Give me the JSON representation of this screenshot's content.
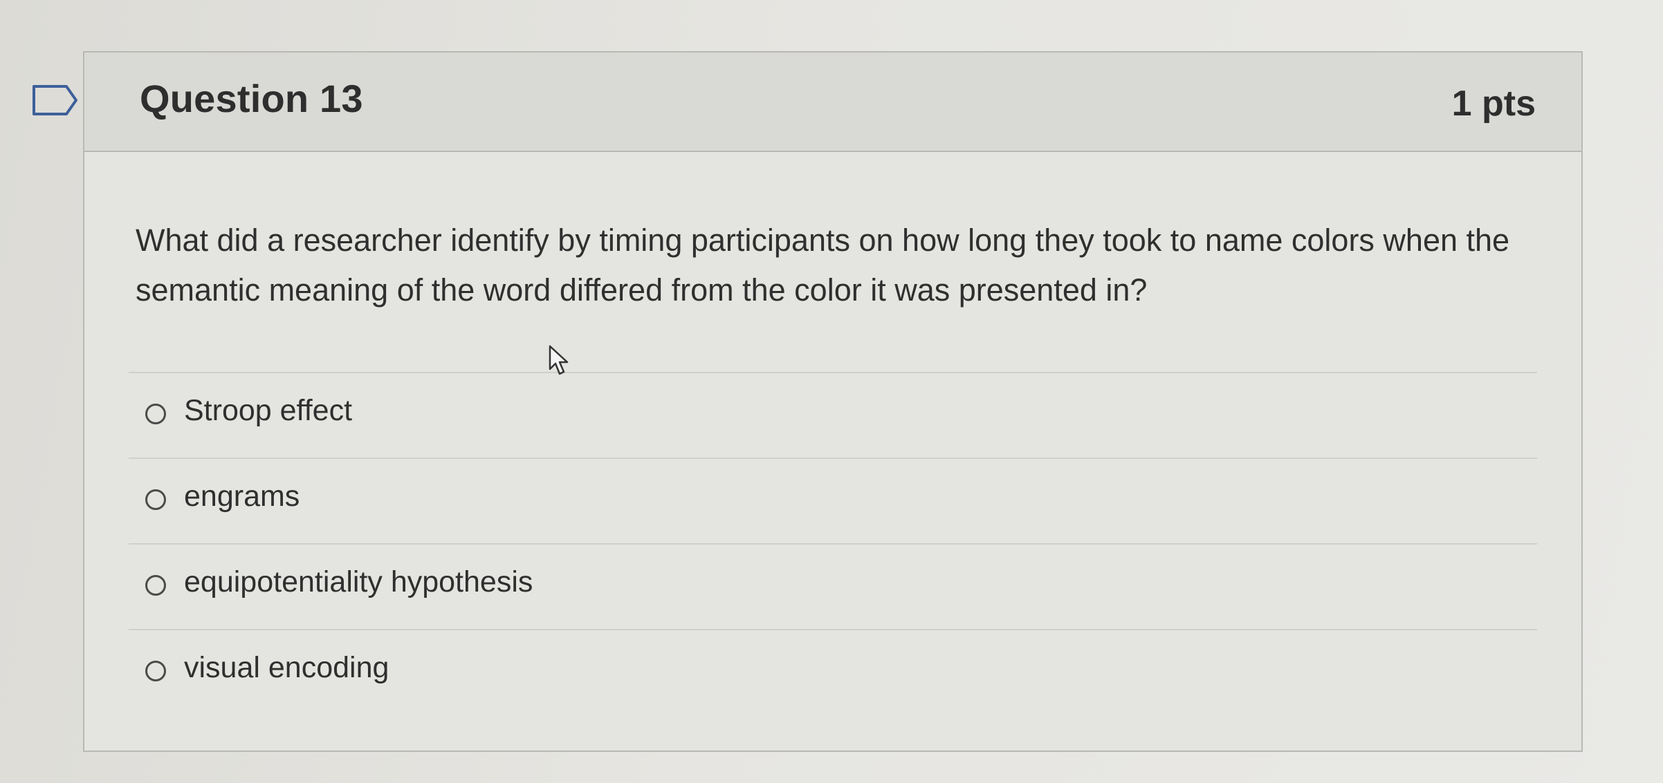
{
  "question": {
    "title": "Question 13",
    "points": "1 pts",
    "text": "What did a researcher identify by timing participants on how long they took to name colors when the semantic meaning of the word differed from the color it was presented in?"
  },
  "answers": [
    {
      "label": "Stroop effect",
      "selected": false
    },
    {
      "label": "engrams",
      "selected": false
    },
    {
      "label": "equipotentiality hypothesis",
      "selected": false
    },
    {
      "label": "visual encoding",
      "selected": false
    }
  ],
  "icons": {
    "flag": "flag-icon",
    "cursor": "mouse-pointer-icon",
    "radio": "radio-circle-icon"
  },
  "colors": {
    "background": "#e2e1dd",
    "header": "#d9d9d5",
    "border": "#b8b8b4",
    "text": "#2e2e2e"
  }
}
